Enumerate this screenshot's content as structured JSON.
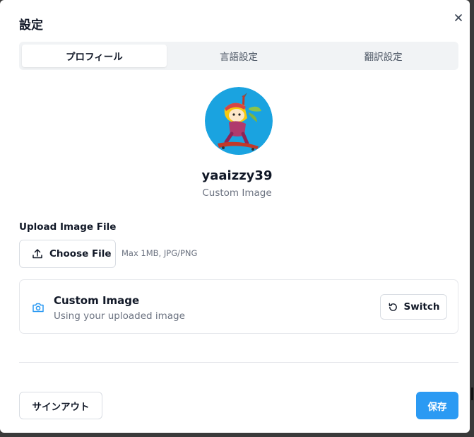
{
  "dialog": {
    "title": "設定",
    "close_icon": "close-icon"
  },
  "tabs": [
    {
      "label": "プロフィール",
      "active": true
    },
    {
      "label": "言語設定",
      "active": false
    },
    {
      "label": "翻訳設定",
      "active": false
    }
  ],
  "profile": {
    "avatar_icon": "avatar-image",
    "username": "yaaizzy39",
    "avatar_type": "Custom Image"
  },
  "upload": {
    "label": "Upload Image File",
    "choose_label": "Choose File",
    "choose_icon": "upload-icon",
    "hint": "Max 1MB, JPG/PNG"
  },
  "image_source": {
    "icon": "camera-icon",
    "title": "Custom Image",
    "subtitle": "Using your uploaded image",
    "switch_label": "Switch",
    "switch_icon": "rotate-icon"
  },
  "footer": {
    "signout_label": "サインアウト",
    "save_label": "保存"
  },
  "colors": {
    "accent": "#2b9af3",
    "avatar_bg": "#1aa3e0",
    "tabs_bg": "#f1f3f5"
  }
}
